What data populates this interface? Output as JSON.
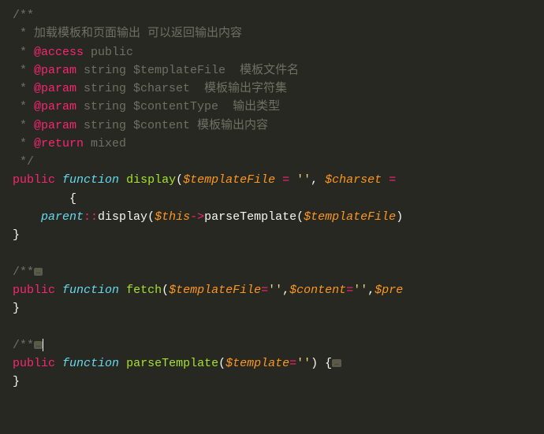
{
  "comment_block1": {
    "open": "/**",
    "l1_star": " * ",
    "l1_text": "加载模板和页面输出 可以返回输出内容",
    "l2_star": " * ",
    "l2_tag": "@access",
    "l2_text": " public",
    "l3_star": " * ",
    "l3_tag": "@param",
    "l3_text": " string $templateFile  模板文件名",
    "l4_star": " * ",
    "l4_tag": "@param",
    "l4_text": " string $charset  模板输出字符集",
    "l5_star": " * ",
    "l5_tag": "@param",
    "l5_text": " string $contentType  输出类型",
    "l6_star": " * ",
    "l6_tag": "@param",
    "l6_text": " string $content 模板输出内容",
    "l7_star": " * ",
    "l7_tag": "@return",
    "l7_text": " mixed",
    "close": " */"
  },
  "fn1": {
    "public": "public",
    "function": "function",
    "name": "display",
    "p1": "$templateFile",
    "eq": " = ",
    "s1": "''",
    "comma": ", ",
    "p2": "$charset",
    "eq2": " = ",
    "lbrace": "{",
    "indent": "        ",
    "parent": "parent",
    "scope": "::",
    "call1": "display",
    "this": "$this",
    "arrow": "->",
    "call2": "parseTemplate",
    "var2": "$templateFile",
    "rbrace": "}"
  },
  "comment_block2": {
    "open": "/**",
    "fold": "…"
  },
  "fn2": {
    "public": "public",
    "function": "function",
    "name": "fetch",
    "p1": "$templateFile",
    "eq": "=",
    "s1": "''",
    "c1": ",",
    "p2": "$content",
    "s2": "''",
    "c2": ",",
    "p3": "$pre",
    "rbrace": "}"
  },
  "comment_block3": {
    "open": "/**",
    "fold": "…"
  },
  "fn3": {
    "public": "public",
    "function": "function",
    "name": "parseTemplate",
    "p1": "$template",
    "eq": "=",
    "s1": "''",
    "brace_open": " {",
    "fold": "…",
    "rbrace": "}"
  }
}
